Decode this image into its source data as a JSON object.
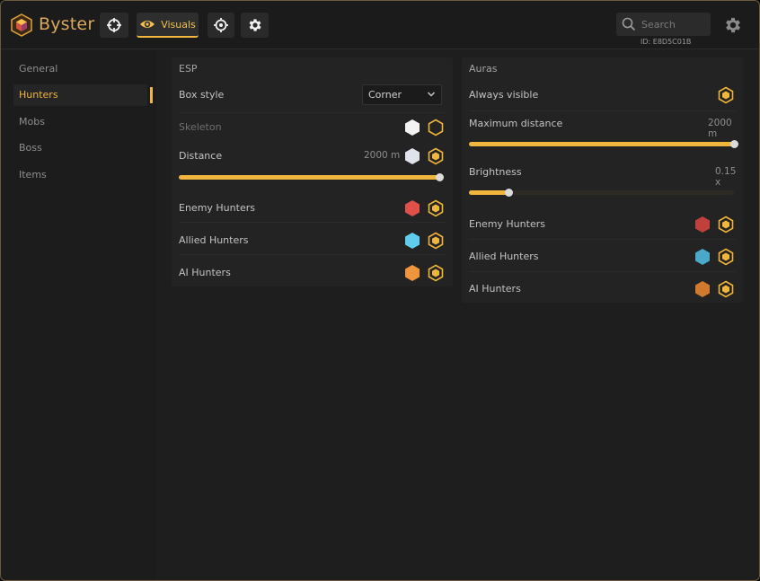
{
  "header": {
    "brand": "Byster",
    "nav": [
      {
        "icon": "crosshair-icon",
        "label": ""
      },
      {
        "icon": "eye-icon",
        "label": "Visuals",
        "active": true
      },
      {
        "icon": "target-icon",
        "label": ""
      },
      {
        "icon": "gear-icon",
        "label": ""
      }
    ],
    "search_placeholder": "Search",
    "client_id": "ID: E8D5C01B"
  },
  "sidebar": {
    "items": [
      {
        "label": "General",
        "active": false
      },
      {
        "label": "Hunters",
        "active": true
      },
      {
        "label": "Mobs",
        "active": false
      },
      {
        "label": "Boss",
        "active": false
      },
      {
        "label": "Items",
        "active": false
      }
    ]
  },
  "esp": {
    "title": "ESP",
    "box_style_label": "Box style",
    "box_style_value": "Corner",
    "skeleton_label": "Skeleton",
    "distance_label": "Distance",
    "distance_value": "2000 m",
    "distance_fraction": 1.0,
    "enemy_label": "Enemy Hunters",
    "allied_label": "Allied Hunters",
    "ai_label": "AI Hunters"
  },
  "auras": {
    "title": "Auras",
    "always_visible_label": "Always visible",
    "max_distance_label": "Maximum distance",
    "max_distance_value": "2000 m",
    "max_distance_fraction": 1.0,
    "brightness_label": "Brightness",
    "brightness_value": "0.15 x",
    "brightness_fraction": 0.15,
    "enemy_label": "Enemy Hunters",
    "allied_label": "Allied Hunters",
    "ai_label": "AI Hunters"
  },
  "colors": {
    "accent": "#f0b53c",
    "white": "#f2f2f2",
    "enemy_esp": "#e0504b",
    "allied_esp": "#5fcdee",
    "ai_esp": "#f0953b",
    "enemy_aura": "#c0403c",
    "allied_aura": "#4aa9c9",
    "ai_aura": "#d07a2f"
  }
}
